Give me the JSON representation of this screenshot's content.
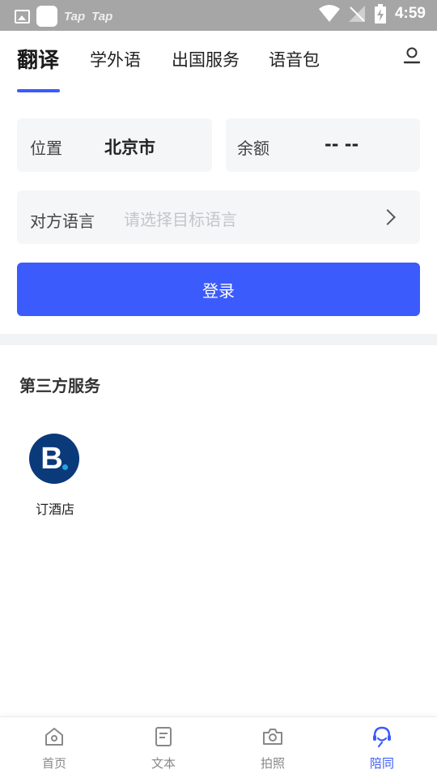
{
  "status_bar": {
    "tap1": "Tap",
    "tap2": "Tap",
    "time": "4:59"
  },
  "top_tabs": [
    {
      "label": "翻译",
      "active": true
    },
    {
      "label": "学外语",
      "active": false
    },
    {
      "label": "出国服务",
      "active": false
    },
    {
      "label": "语音包",
      "active": false
    }
  ],
  "location": {
    "label": "位置",
    "value": "北京市"
  },
  "balance": {
    "label": "余额",
    "value": "-- --"
  },
  "target_language": {
    "label": "对方语言",
    "placeholder": "请选择目标语言"
  },
  "login_button": "登录",
  "third_party": {
    "title": "第三方服务",
    "items": [
      {
        "logo_letter": "B",
        "label": "订酒店"
      }
    ]
  },
  "bottom_nav": [
    {
      "label": "首页",
      "icon": "home-icon",
      "active": false
    },
    {
      "label": "文本",
      "icon": "document-icon",
      "active": false
    },
    {
      "label": "拍照",
      "icon": "camera-icon",
      "active": false
    },
    {
      "label": "陪同",
      "icon": "companion-icon",
      "active": true
    }
  ],
  "colors": {
    "accent": "#3b5bfc",
    "card_bg": "#f5f6f8",
    "logo_bg": "#0b3a7a"
  }
}
